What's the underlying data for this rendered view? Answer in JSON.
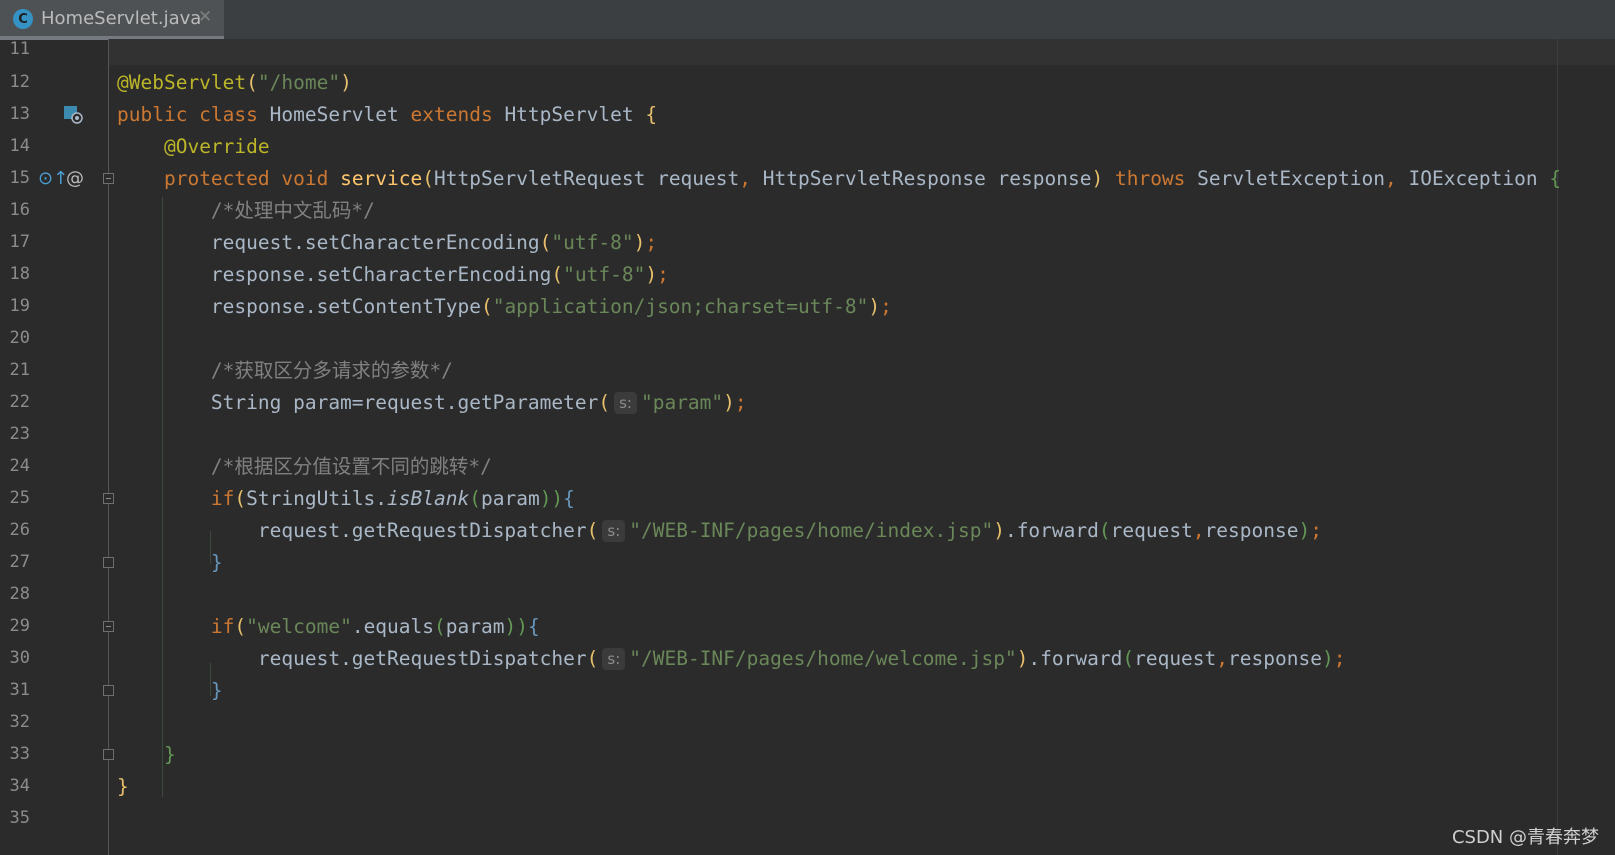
{
  "tab": {
    "icon": "C",
    "label": "HomeServlet.java",
    "close": "✕"
  },
  "gutter_markers": {
    "implements": "⊙↑",
    "annotation": "@"
  },
  "code": {
    "l11": {
      "num": "11"
    },
    "l12": {
      "num": "12",
      "ann": "@WebServlet",
      "p1": "(",
      "s1": "\"/home\"",
      "p2": ")"
    },
    "l13": {
      "num": "13",
      "kw1": "public class ",
      "t1": "HomeServlet ",
      "kw2": "extends ",
      "t2": "HttpServlet ",
      "b1": "{"
    },
    "l14": {
      "num": "14",
      "ann": "@Override"
    },
    "l15": {
      "num": "15",
      "kw1": "protected void ",
      "fn": "service",
      "p1": "(",
      "t1": "HttpServletRequest request",
      "c1": ", ",
      "t2": "HttpServletResponse response",
      "p2": ")",
      "kw2": " throws ",
      "t3": "ServletException",
      "c2": ", ",
      "t4": "IOException ",
      "b1": "{"
    },
    "l16": {
      "num": "16",
      "cmt": "/*处理中文乱码*/"
    },
    "l17": {
      "num": "17",
      "t1": "request.setCharacterEncoding",
      "p1": "(",
      "s1": "\"utf-8\"",
      "p2": ")",
      "c1": ";"
    },
    "l18": {
      "num": "18",
      "t1": "response.setCharacterEncoding",
      "p1": "(",
      "s1": "\"utf-8\"",
      "p2": ")",
      "c1": ";"
    },
    "l19": {
      "num": "19",
      "t1": "response.setContentType",
      "p1": "(",
      "s1": "\"application/json;charset=utf-8\"",
      "p2": ")",
      "c1": ";"
    },
    "l20": {
      "num": "20"
    },
    "l21": {
      "num": "21",
      "cmt": "/*获取区分多请求的参数*/"
    },
    "l22": {
      "num": "22",
      "t1": "String param=request.getParameter",
      "p1": "(",
      "hint": "s:",
      "s1": "\"param\"",
      "p2": ")",
      "c1": ";"
    },
    "l23": {
      "num": "23"
    },
    "l24": {
      "num": "24",
      "cmt": "/*根据区分值设置不同的跳转*/"
    },
    "l25": {
      "num": "25",
      "kw1": "if",
      "p1": "(",
      "t1": "StringUtils.",
      "it": "isBlank",
      "p2": "(",
      "t2": "param",
      "p3": "))",
      "b1": "{"
    },
    "l26": {
      "num": "26",
      "t1": "request.getRequestDispatcher",
      "p1": "(",
      "hint": "s:",
      "s1": "\"/WEB-INF/pages/home/index.jsp\"",
      "p2": ")",
      "t2": ".forward",
      "p3": "(",
      "t3": "request",
      "c1": ",",
      "t4": "response",
      "p4": ")",
      "c2": ";"
    },
    "l27": {
      "num": "27",
      "b1": "}"
    },
    "l28": {
      "num": "28"
    },
    "l29": {
      "num": "29",
      "kw1": "if",
      "p1": "(",
      "s1": "\"welcome\"",
      "t1": ".equals",
      "p2": "(",
      "t2": "param",
      "p3": "))",
      "b1": "{"
    },
    "l30": {
      "num": "30",
      "t1": "request.getRequestDispatcher",
      "p1": "(",
      "hint": "s:",
      "s1": "\"/WEB-INF/pages/home/welcome.jsp\"",
      "p2": ")",
      "t2": ".forward",
      "p3": "(",
      "t3": "request",
      "c1": ",",
      "t4": "response",
      "p4": ")",
      "c2": ";"
    },
    "l31": {
      "num": "31",
      "b1": "}"
    },
    "l32": {
      "num": "32"
    },
    "l33": {
      "num": "33",
      "b1": "}"
    },
    "l34": {
      "num": "34",
      "b1": "}"
    },
    "l35": {
      "num": "35"
    }
  },
  "watermark": "CSDN @青春奔梦"
}
